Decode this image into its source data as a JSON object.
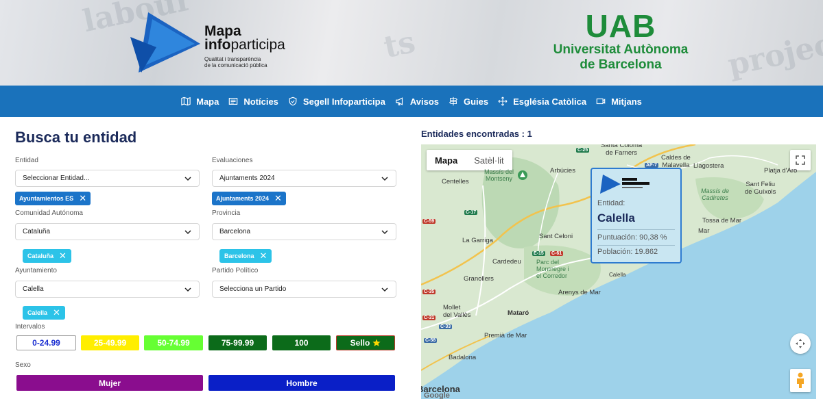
{
  "header": {
    "logo": {
      "line1": "Mapa",
      "line2_bold": "info",
      "line2_light": "participa",
      "tagline1": "Qualitat i transparència",
      "tagline2": "de la comunicació pública"
    },
    "uab": {
      "acronym": "UAB",
      "line1": "Universitat Autònoma",
      "line2": "de Barcelona"
    }
  },
  "nav": {
    "items": [
      {
        "label": "Mapa",
        "icon": "map-icon"
      },
      {
        "label": "Notícies",
        "icon": "newspaper-icon"
      },
      {
        "label": "Segell Infoparticipa",
        "icon": "shield-icon"
      },
      {
        "label": "Avisos",
        "icon": "megaphone-icon"
      },
      {
        "label": "Guies",
        "icon": "signpost-icon"
      },
      {
        "label": "Església Catòlica",
        "icon": "cross-arrows-icon"
      },
      {
        "label": "Mitjans",
        "icon": "media-icon"
      }
    ],
    "color": "#1a72bb"
  },
  "search": {
    "title": "Busca tu entidad",
    "entidad": {
      "label": "Entidad",
      "value": "Seleccionar Entidad...",
      "chip": "Ayuntamientos ES"
    },
    "evaluaciones": {
      "label": "Evaluaciones",
      "value": "Ajuntaments 2024",
      "chip": "Ajuntaments 2024"
    },
    "comunidad": {
      "label": "Comunidad Autónoma",
      "value": "Cataluña",
      "chip": "Cataluña"
    },
    "provincia": {
      "label": "Provincia",
      "value": "Barcelona",
      "chip": "Barcelona"
    },
    "ayuntamiento": {
      "label": "Ayuntamiento",
      "value": "Calella",
      "chip": "Calella"
    },
    "partido": {
      "label": "Partido Político",
      "value": "Selecciona un Partido"
    },
    "chip_remove": "✕",
    "intervals_label": "Intervalos",
    "intervals": [
      {
        "label": "0-24.99",
        "bg": "#ffffff",
        "fg": "#1b2fd1"
      },
      {
        "label": "25-49.99",
        "bg": "#ffee00",
        "fg": "#ffffff"
      },
      {
        "label": "50-74.99",
        "bg": "#66ff33",
        "fg": "#ffffff"
      },
      {
        "label": "75-99.99",
        "bg": "#0c6b1a",
        "fg": "#ffffff"
      },
      {
        "label": "100",
        "bg": "#0c6b1a",
        "fg": "#ffffff"
      },
      {
        "label": "Sello",
        "bg": "#0c6b1a",
        "fg": "#ffffff",
        "icon": "star-icon"
      }
    ],
    "sexo_label": "Sexo",
    "sexo": [
      {
        "label": "Mujer",
        "bg": "#8a0d8e"
      },
      {
        "label": "Hombre",
        "bg": "#0a1fc7"
      }
    ]
  },
  "results": {
    "found": "Entidades encontradas : 1"
  },
  "map": {
    "types": [
      "Mapa",
      "Satèl·lit"
    ],
    "active_type": "Mapa",
    "labels": {
      "santa_coloma": "Santa Coloma\nde Farners",
      "caldes": "Caldes de\nMalavella",
      "llagostera": "Llagostera",
      "platja": "Platja d'Aro",
      "sant_feliu": "Sant Feliu\nde Guíxols",
      "massis_cadiretes": "Massís de\nCadiretes",
      "tossa": "Tossa de Mar",
      "arbucies": "Arbúcies",
      "centelles": "Centelles",
      "montseny": "Massís del\nMontseny",
      "la_garriga": "La Garriga",
      "sant_celoni": "Sant Celoni",
      "cardedeu": "Cardedeu",
      "montnegre": "Parc del\nMontnegre i\nel Corredor",
      "granollers": "Granollers",
      "arenys": "Arenys de Mar",
      "mataro": "Mataró",
      "mollet": "Mollet\ndel Vallès",
      "premia": "Premià de Mar",
      "badalona": "Badalona",
      "barcelona": "Barcelona",
      "calella": "Calella",
      "google": "Google",
      "mar": "Mar"
    },
    "roads": [
      "C-25",
      "AP-7",
      "C-59",
      "C-17",
      "E-15",
      "C-61",
      "C-33",
      "C-58",
      "C-31",
      "C-35"
    ],
    "info": {
      "entity_label": "Entidad:",
      "entity": "Calella",
      "puntuacion": "Puntuación: 90,38 %",
      "poblacion": "Población: 19.862"
    },
    "marker_color": "#0c6b1a"
  }
}
